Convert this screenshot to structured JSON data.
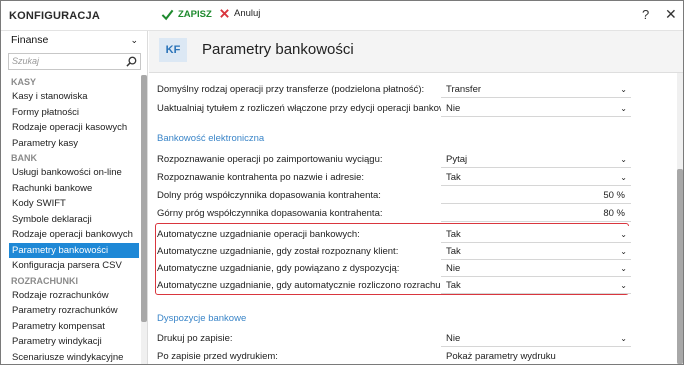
{
  "app": {
    "title": "KONFIGURACJA",
    "save_label": "ZAPISZ",
    "cancel_label": "Anuluj",
    "help_label": "?",
    "close_label": "✕"
  },
  "sidebar": {
    "module": "Finanse",
    "search_placeholder": "Szukaj",
    "groups": [
      {
        "header": "KASY",
        "items": [
          "Kasy i stanowiska",
          "Formy płatności",
          "Rodzaje operacji kasowych",
          "Parametry kasy"
        ]
      },
      {
        "header": "BANK",
        "items": [
          "Usługi bankowości on-line",
          "Rachunki bankowe",
          "Kody SWIFT",
          "Symbole deklaracji",
          "Rodzaje operacji bankowych",
          "Parametry bankowości",
          "Konfiguracja parsera CSV"
        ]
      },
      {
        "header": "ROZRACHUNKI",
        "items": [
          "Rodzaje rozrachunków",
          "Parametry rozrachunków",
          "Parametry kompensat",
          "Parametry windykacji",
          "Scenariusze windykacyjne"
        ]
      }
    ],
    "selected": "Parametry bankowości"
  },
  "header": {
    "badge": "KF",
    "title": "Parametry bankowości"
  },
  "form": {
    "rows_top": [
      {
        "label": "Domyślny rodzaj operacji przy transferze (podzielona płatność):",
        "value": "Transfer"
      },
      {
        "label": "Uaktualniaj tytułem z rozliczeń włączone przy edycji operacji bankowej:",
        "value": "Nie"
      }
    ],
    "section1": "Bankowość elektroniczna",
    "rows_mid": [
      {
        "label": "Rozpoznawanie operacji po zaimportowaniu wyciągu:",
        "value": "Pytaj"
      },
      {
        "label": "Rozpoznawanie kontrahenta po nazwie i adresie:",
        "value": "Tak"
      },
      {
        "label": "Dolny próg współczynnika dopasowania kontrahenta:",
        "value": "50",
        "unit": "%"
      },
      {
        "label": "Górny próg współczynnika dopasowania kontrahenta:",
        "value": "80",
        "unit": "%"
      }
    ],
    "rows_auto": [
      {
        "label": "Automatyczne uzgadnianie operacji bankowych:",
        "value": "Tak"
      },
      {
        "label": "Automatyczne uzgadnianie, gdy został rozpoznany klient:",
        "value": "Tak"
      },
      {
        "label": "Automatyczne uzgadnianie, gdy powiązano z dyspozycją:",
        "value": "Nie"
      },
      {
        "label": "Automatyczne uzgadnianie, gdy automatycznie rozliczono rozrachunek:",
        "value": "Tak"
      }
    ],
    "section2": "Dyspozycje bankowe",
    "rows_bottom": [
      {
        "label": "Drukuj po zapisie:",
        "value": "Nie"
      },
      {
        "label": "Po zapisie przed wydrukiem:",
        "value": "Pokaż parametry wydruku"
      }
    ]
  },
  "colors": {
    "accent": "#1e88d6",
    "save": "#1e8a2e",
    "section": "#3a85c8",
    "highlight": "#d9363e"
  }
}
